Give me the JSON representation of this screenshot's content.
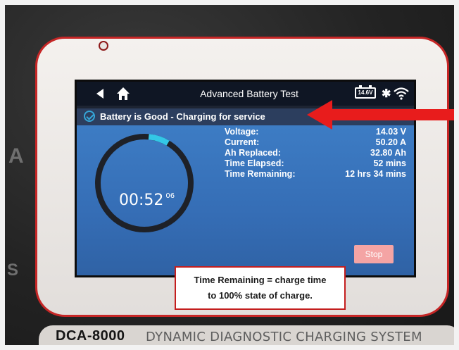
{
  "screen": {
    "title": "Advanced Battery Test",
    "battery_voltage_badge": "14.6V",
    "status_message": "Battery is Good - Charging for service",
    "timer": {
      "main": "00:52",
      "seconds": "06"
    },
    "ring_progress_percent": 7,
    "stats": [
      {
        "label": "Voltage:",
        "value": "14.03 V"
      },
      {
        "label": "Current:",
        "value": "50.20 A"
      },
      {
        "label": "Ah Replaced:",
        "value": "32.80 Ah"
      },
      {
        "label": "Time Elapsed:",
        "value": "52 mins"
      },
      {
        "label": "Time Remaining:",
        "value": "12 hrs 34 mins"
      }
    ],
    "stop_label": "Stop"
  },
  "callout": {
    "line1": "Time Remaining = charge time",
    "line2": "to 100% state of charge."
  },
  "device": {
    "brand": "DCA-8000",
    "subtitle": "DYNAMIC DIAGNOSTIC CHARGING SYSTEM",
    "left_glyph_top": "A",
    "left_glyph_bottom": "S"
  },
  "icons": {
    "back": "back-arrow-icon",
    "home": "home-icon",
    "battery": "battery-icon",
    "bluetooth": "bluetooth-icon",
    "wifi": "wifi-icon",
    "status": "check-circle-icon"
  },
  "colors": {
    "screen_blue": "#3d7cc4",
    "progress_cyan": "#33c7e6",
    "status_bar": "#2c3e5e",
    "stop_button": "#f4a4a4",
    "bezel_red": "#c62626",
    "callout_red": "#c41e1e"
  }
}
